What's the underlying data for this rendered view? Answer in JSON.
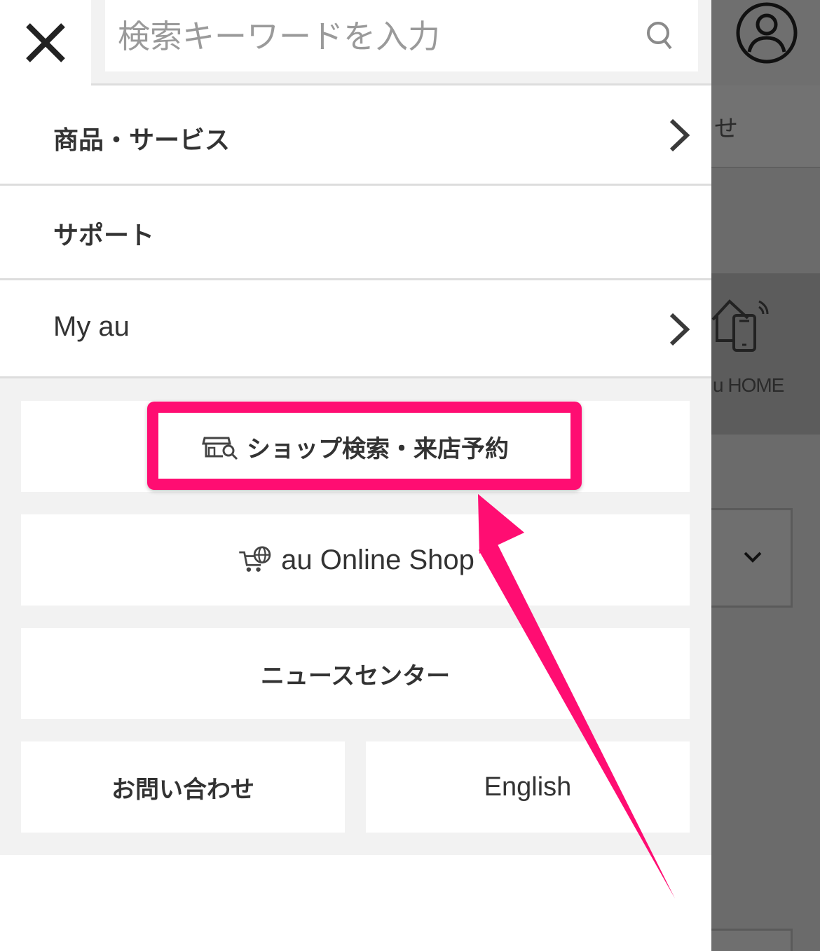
{
  "search": {
    "placeholder": "検索キーワードを入力"
  },
  "nav": {
    "products": "商品・サービス",
    "support": "サポート",
    "myau": "My au"
  },
  "links": {
    "shop": "ショップ検索・来店予約",
    "online": "au Online Shop",
    "news": "ニュースセンター",
    "contact": "お問い合わせ",
    "english": "English"
  },
  "background": {
    "band_text": "せ",
    "home_label": "u HOME"
  },
  "icons": {
    "close": "close-icon",
    "search": "search-icon",
    "chevron": "chevron-right-icon",
    "shop": "shop-search-icon",
    "online": "cart-globe-icon",
    "account": "account-icon",
    "home": "home-phone-icon"
  },
  "colors": {
    "accent": "#ff0d72",
    "text": "#333333",
    "panel": "#f2f2f2",
    "dim": "#6b6b6b"
  }
}
